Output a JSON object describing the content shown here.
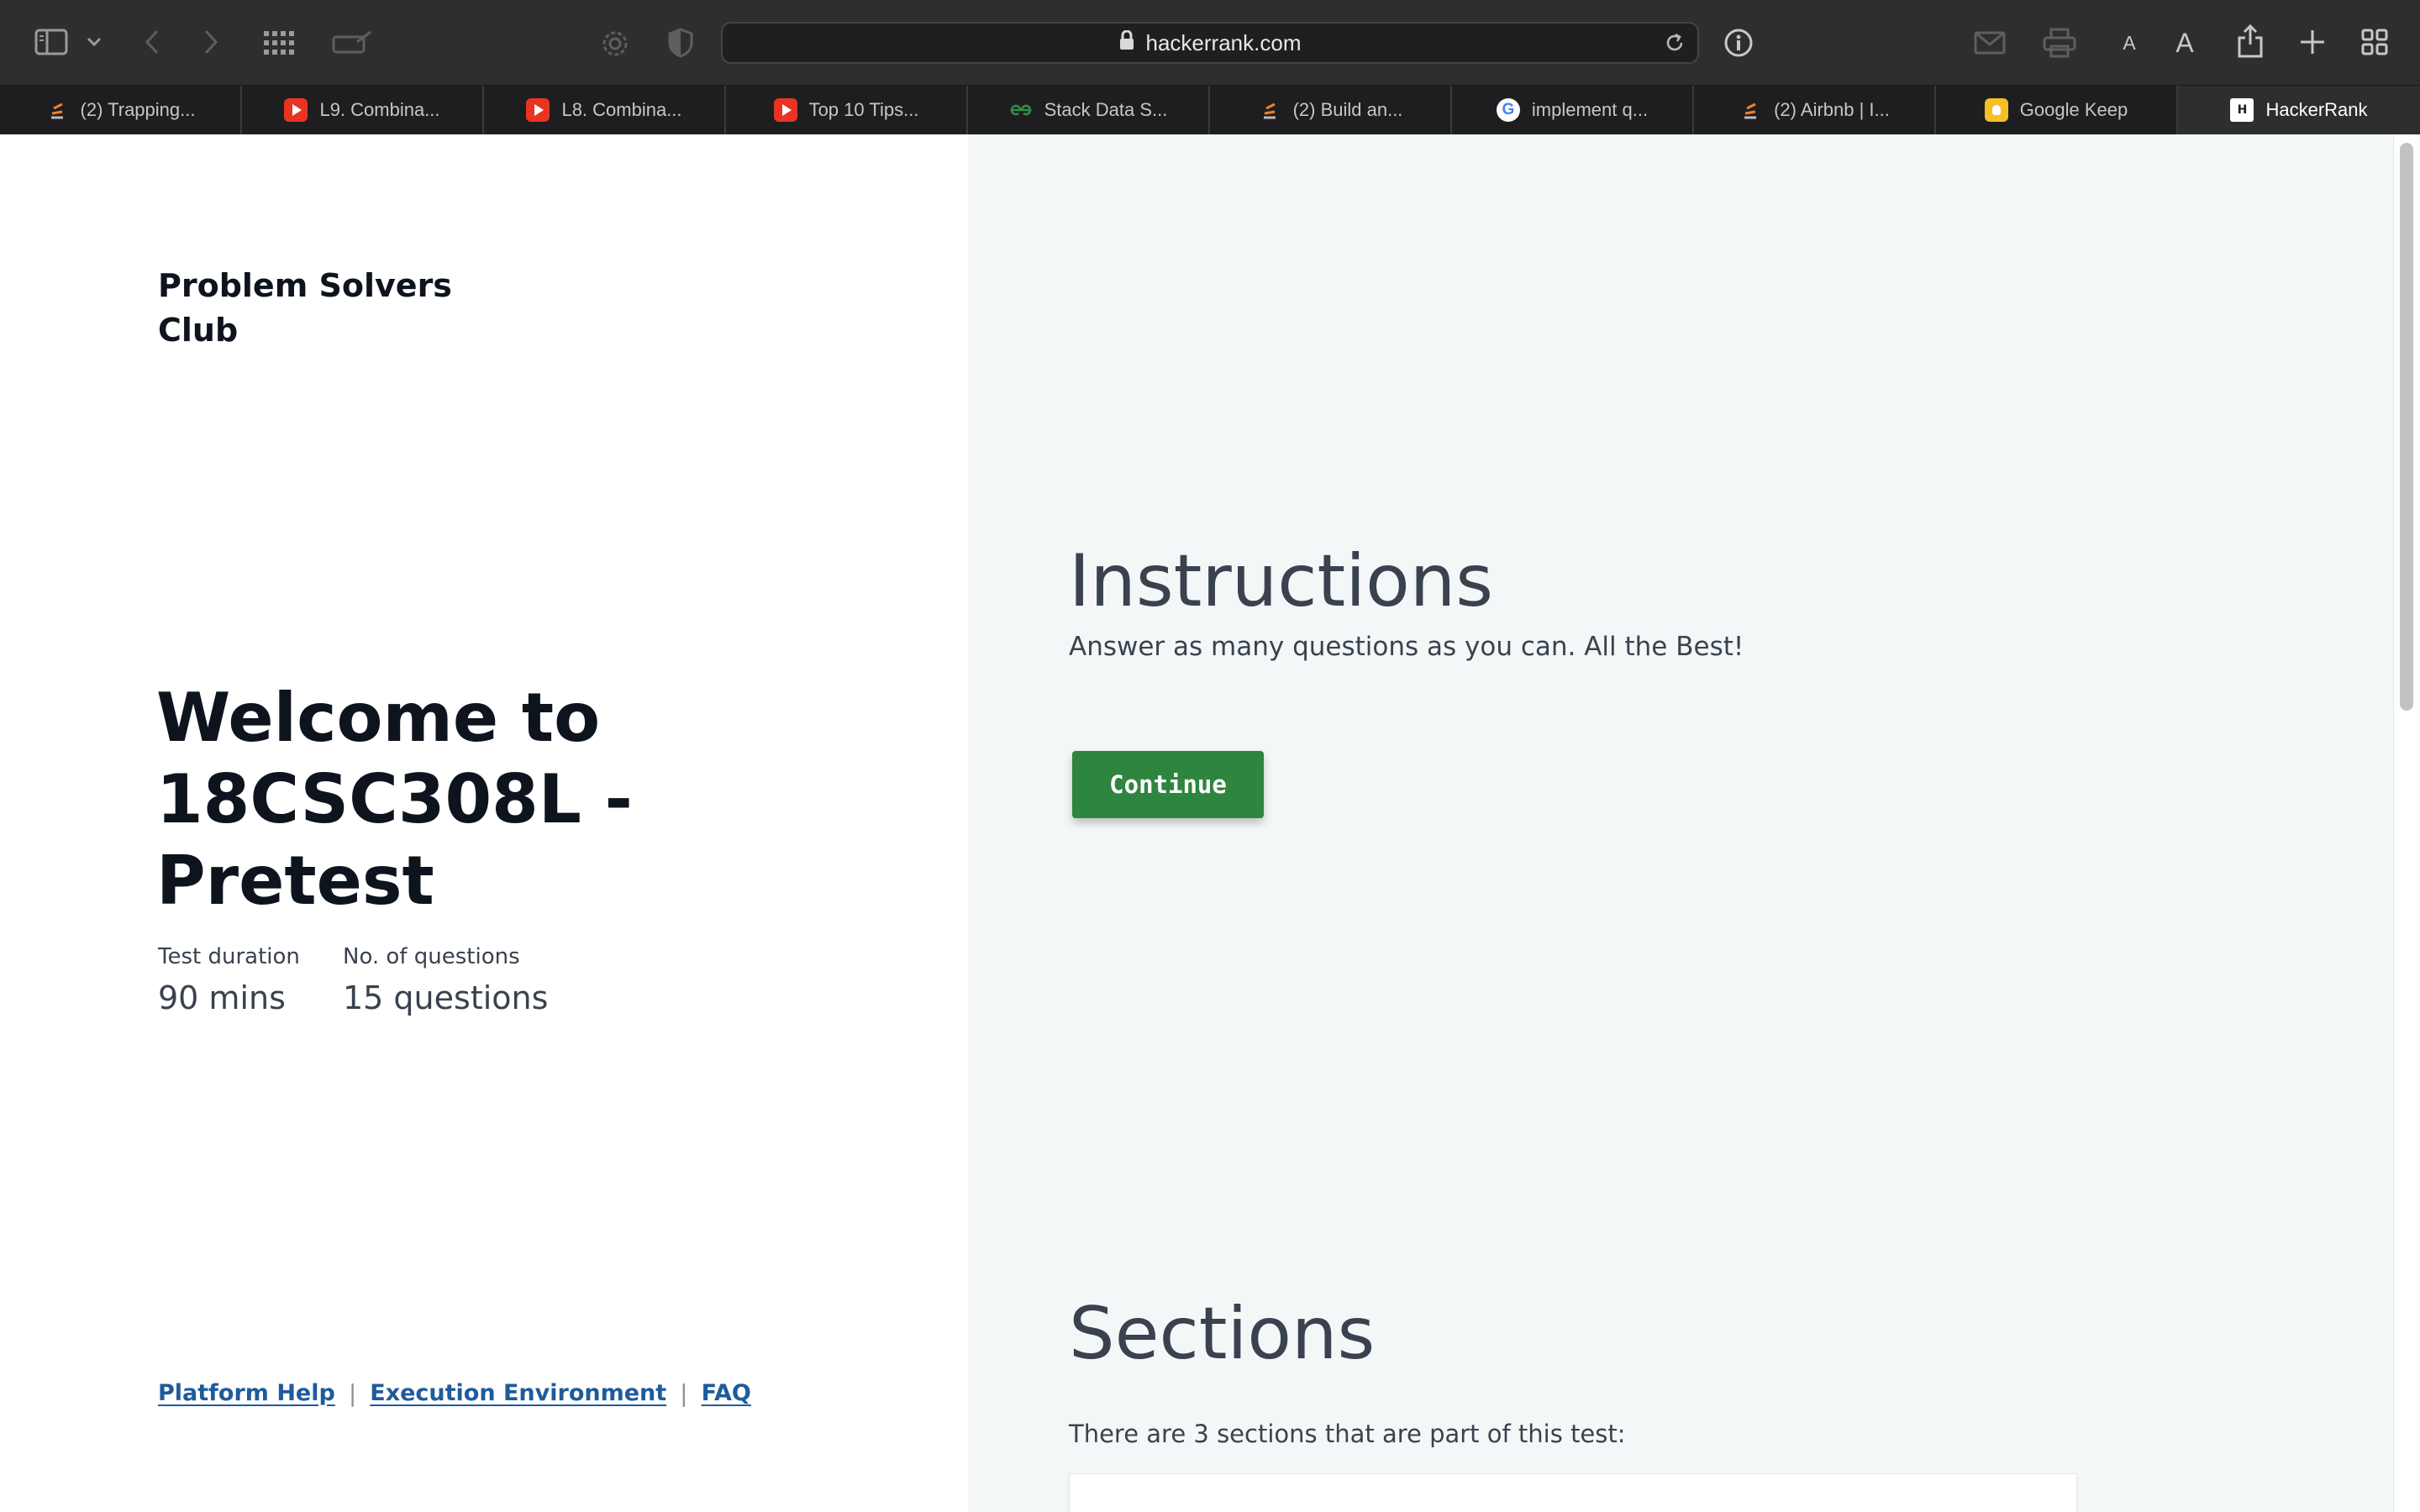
{
  "browser": {
    "url": "hackerrank.com",
    "tabs": [
      {
        "label": "(2) Trapping...",
        "icon": "stackoverflow-icon"
      },
      {
        "label": "L9. Combina...",
        "icon": "youtube-icon"
      },
      {
        "label": "L8. Combina...",
        "icon": "youtube-icon"
      },
      {
        "label": "Top 10 Tips...",
        "icon": "youtube-icon"
      },
      {
        "label": "Stack Data S...",
        "icon": "geeksforgeeks-icon"
      },
      {
        "label": "(2) Build an...",
        "icon": "stackoverflow-icon"
      },
      {
        "label": "implement q...",
        "icon": "google-icon"
      },
      {
        "label": "(2) Airbnb | I...",
        "icon": "stackoverflow-icon"
      },
      {
        "label": "Google Keep",
        "icon": "google-keep-icon"
      },
      {
        "label": "HackerRank",
        "icon": "hackerrank-icon",
        "active": true
      }
    ]
  },
  "left": {
    "org_name": "Problem Solvers Club",
    "welcome_title": "Welcome to 18CSC308L - Pretest",
    "duration_label": "Test duration",
    "duration_value": "90 mins",
    "questions_label": "No. of questions",
    "questions_value": "15 questions",
    "footer": {
      "platform_help": "Platform Help",
      "execution_environment": "Execution Environment",
      "faq": "FAQ",
      "separator": "|"
    }
  },
  "right": {
    "instructions_heading": "Instructions",
    "instructions_text": "Answer as many questions as you can. All the Best!",
    "continue_label": "Continue",
    "sections_heading": "Sections",
    "sections_text": "There are 3 sections that are part of this test:"
  },
  "colors": {
    "continue_button": "#2e8540",
    "link": "#1f5b9c",
    "heading_text": "#39424e",
    "right_pane_bg": "#f3f7f7"
  }
}
